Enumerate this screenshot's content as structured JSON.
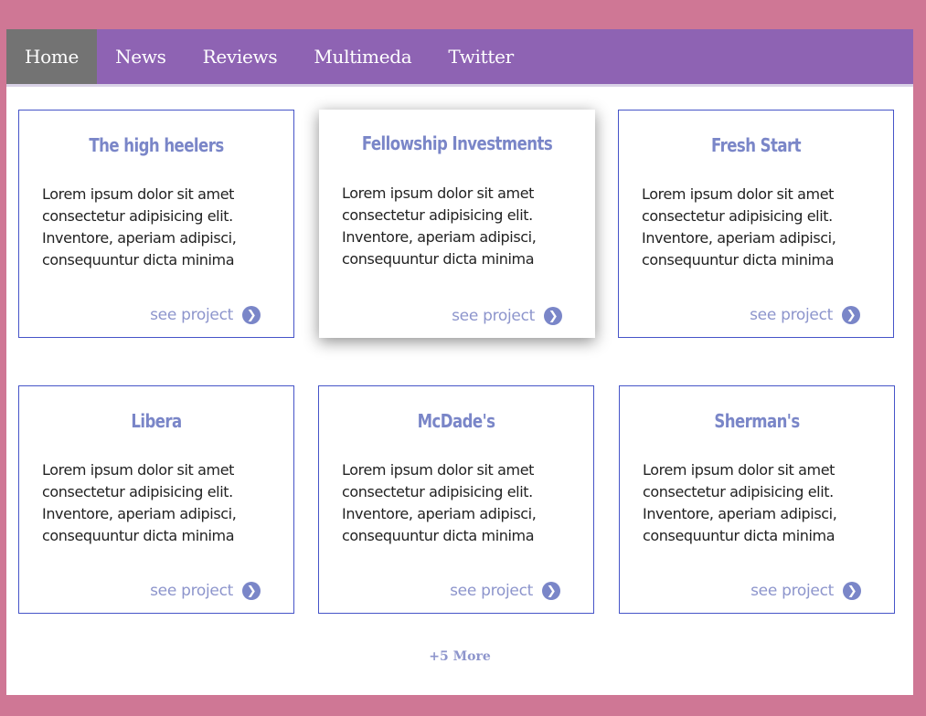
{
  "nav": {
    "items": [
      {
        "label": "Home"
      },
      {
        "label": "News"
      },
      {
        "label": "Reviews"
      },
      {
        "label": "Multimeda"
      },
      {
        "label": "Twitter"
      }
    ]
  },
  "cards": [
    {
      "title": "The high heelers",
      "body": "Lorem ipsum dolor sit amet consectetur adipisicing elit. Inventore, aperiam adipisci, consequuntur dicta minima",
      "link": "see project"
    },
    {
      "title": "Fellowship Investments",
      "body": "Lorem ipsum dolor sit amet consectetur adipisicing elit. Inventore, aperiam adipisci, consequuntur dicta minima",
      "link": "see project"
    },
    {
      "title": "Fresh Start",
      "body": "Lorem ipsum dolor sit amet consectetur adipisicing elit. Inventore, aperiam adipisci, consequuntur dicta minima",
      "link": "see project"
    },
    {
      "title": "Libera",
      "body": "Lorem ipsum dolor sit amet consectetur adipisicing elit. Inventore, aperiam adipisci, consequuntur dicta minima",
      "link": "see project"
    },
    {
      "title": "McDade's",
      "body": "Lorem ipsum dolor sit amet consectetur adipisicing elit. Inventore, aperiam adipisci, consequuntur dicta minima",
      "link": "see project"
    },
    {
      "title": "Sherman's",
      "body": "Lorem ipsum dolor sit amet consectetur adipisicing elit. Inventore, aperiam adipisci, consequuntur dicta minima",
      "link": "see project"
    }
  ],
  "more_label": "+5 More",
  "colors": {
    "page_bg": "#cf7795",
    "nav_bg": "#8e63b3",
    "nav_active": "#737373",
    "card_border": "#4654c8",
    "title": "#7a86c8",
    "link": "#8d95cc"
  },
  "icons": {
    "card_link": "chevron-right-circle-icon"
  }
}
